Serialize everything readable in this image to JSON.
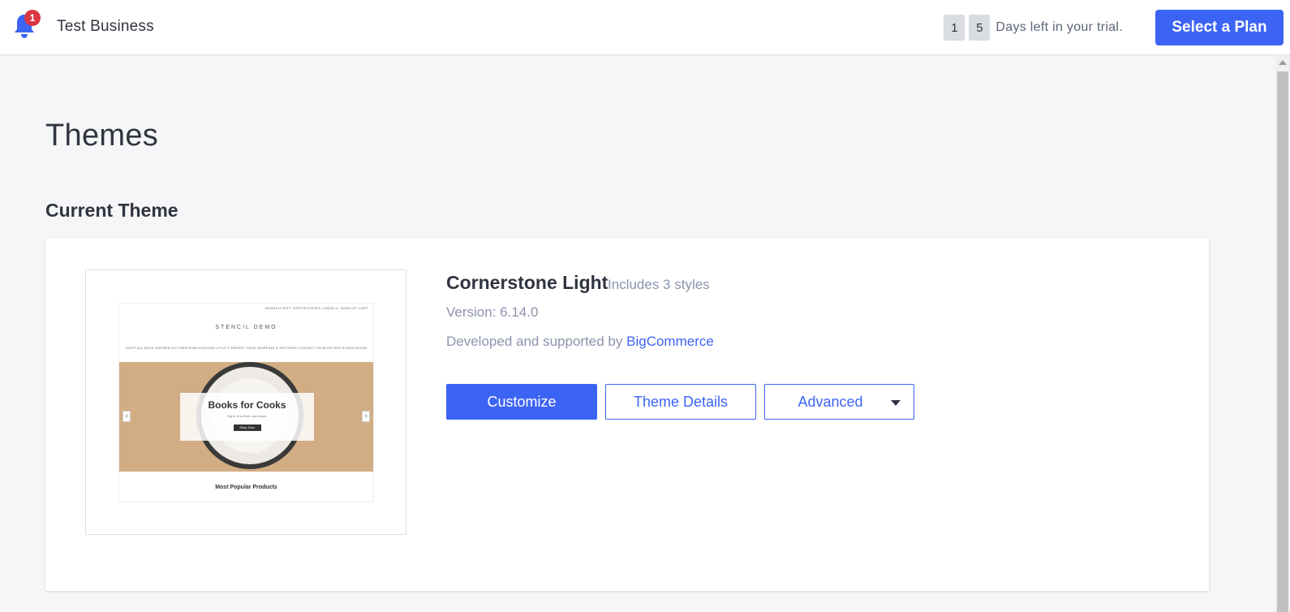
{
  "topbar": {
    "notification_count": "1",
    "store_name": "Test Business",
    "trial_digits": [
      "1",
      "5"
    ],
    "trial_text": "Days left in your trial.",
    "select_plan_label": "Select a Plan"
  },
  "page": {
    "title": "Themes",
    "section_title": "Current Theme"
  },
  "theme": {
    "name": "Cornerstone Light",
    "styles_note": "Includes 3 styles",
    "version": "Version: 6.14.0",
    "developer_prefix": "Developed and supported by",
    "developer_link": "BigCommerce",
    "buttons": {
      "customize": "Customize",
      "details": "Theme Details",
      "advanced": "Advanced"
    },
    "preview": {
      "top_links": "SEARCH  GIFT CERTIFICATES  LOGIN or SIGN UP  CART",
      "logo": "STENCIL DEMO",
      "nav": [
        "SHOP ALL",
        "BATH",
        "GARDEN",
        "KITCHEN",
        "PUBLICATIONS",
        "UTILITY",
        "PARENT PAGE",
        "SHIPPING & RETURNS",
        "CONTACT US",
        "BLOG",
        "RSS SYNDICATION"
      ],
      "hero_title": "Books for Cooks",
      "hero_subtitle": "Dig in to a fresh new recipe",
      "hero_button": "Shop Now",
      "popular_heading": "Most Popular Products"
    }
  },
  "colors": {
    "accent": "#3c64f4",
    "badge": "#db3643",
    "background": "#f5f6f8"
  }
}
